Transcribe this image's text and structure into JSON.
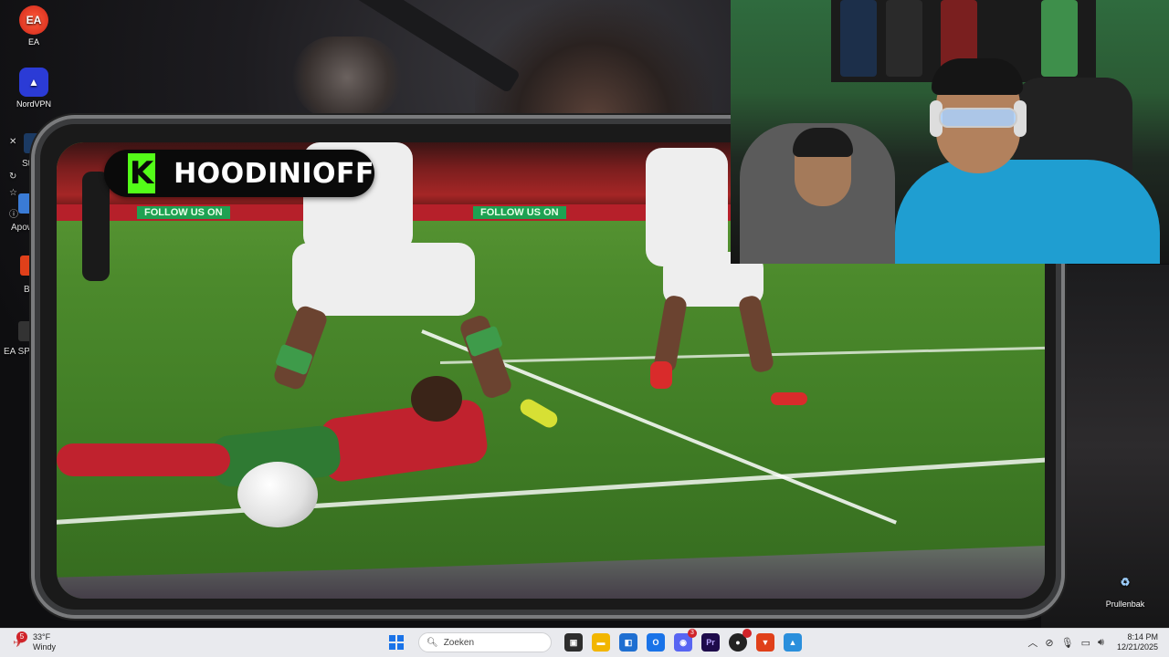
{
  "desktop": {
    "icons": [
      {
        "label": "EA",
        "icon": "ea-icon"
      },
      {
        "label": "NordVPN",
        "icon": "nordvpn-icon"
      },
      {
        "label": "Prullenbak",
        "icon": "recycle-bin-icon"
      }
    ],
    "side_labels": [
      "Ste",
      "Apow",
      "B",
      "EA SPOR"
    ]
  },
  "stream": {
    "channel_logo": "K",
    "channel_name": "HOODINIOFF",
    "board_text": "FOLLOW US ON",
    "brand_color": "#53fc18"
  },
  "taskbar": {
    "weather": {
      "temperature": "33°F",
      "condition": "Windy",
      "badge": "5"
    },
    "search_placeholder": "Zoeken",
    "apps": [
      {
        "name": "task-view",
        "label": "▣",
        "color": "#2d2d2d"
      },
      {
        "name": "file-explorer",
        "label": "▬",
        "color": "#f2b600"
      },
      {
        "name": "store",
        "label": "◧",
        "color": "#1f6fd1"
      },
      {
        "name": "outlook",
        "label": "O",
        "color": "#1a73e8"
      },
      {
        "name": "discord",
        "label": "◉",
        "color": "#5865f2",
        "badge": "3"
      },
      {
        "name": "premiere",
        "label": "Pr",
        "color": "#1e0b4b"
      },
      {
        "name": "obs",
        "label": "●",
        "color": "#222222",
        "badge": ""
      },
      {
        "name": "brave",
        "label": "▼",
        "color": "#e0401a"
      },
      {
        "name": "photos",
        "label": "▲",
        "color": "#2a8fdc"
      }
    ],
    "tray_icons": [
      "chevron-up-icon",
      "network-off-icon",
      "microphone-icon",
      "wifi-icon",
      "speaker-icon"
    ],
    "time": "8:14 PM",
    "date": "12/21/2025"
  }
}
